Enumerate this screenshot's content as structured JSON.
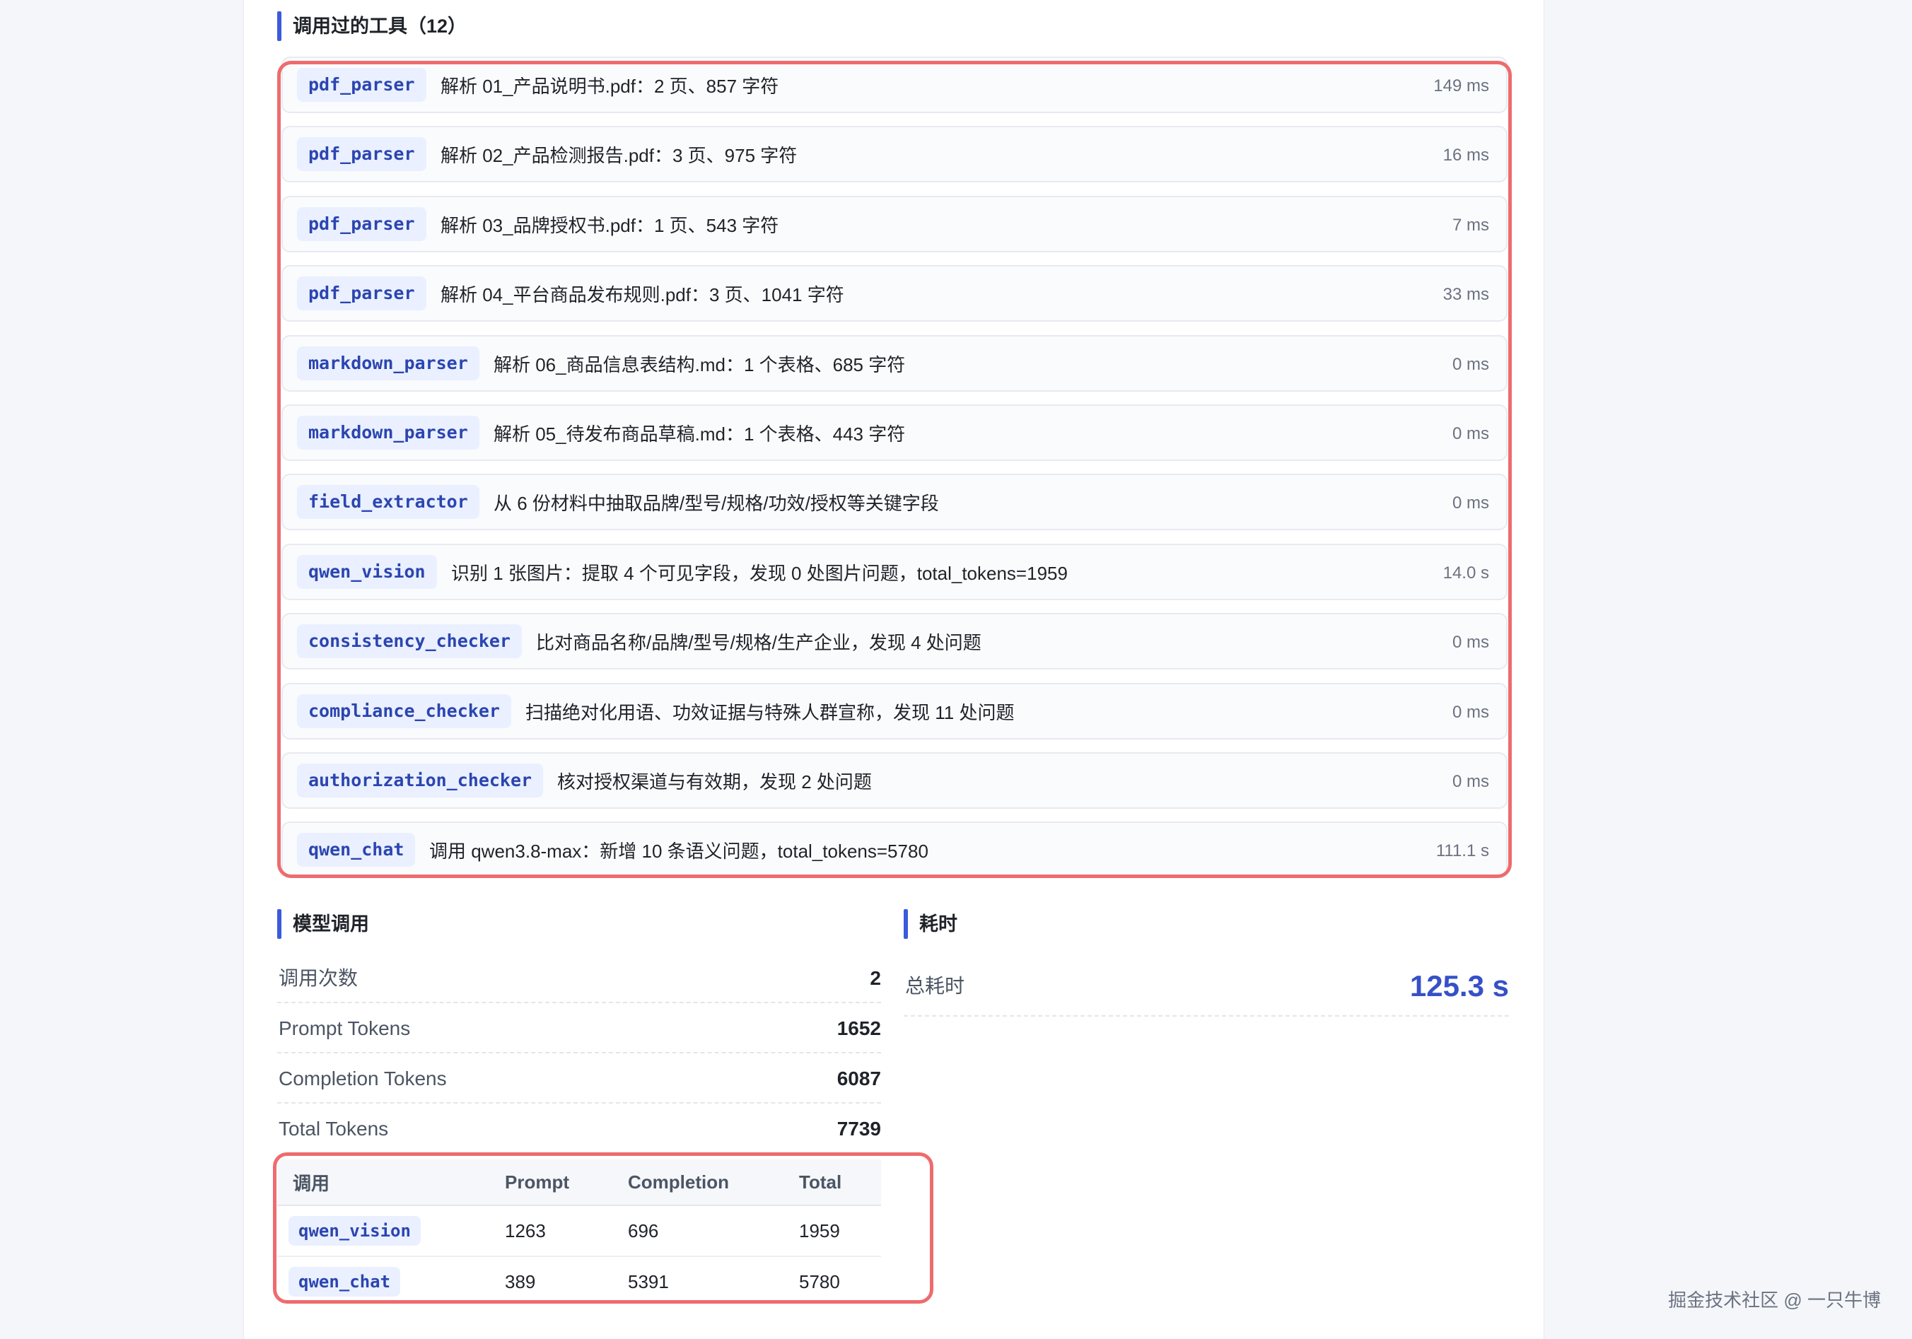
{
  "tools_section": {
    "title": "调用过的工具（12）",
    "items": [
      {
        "tool": "pdf_parser",
        "desc": "解析 01_产品说明书.pdf：2 页、857 字符",
        "duration": "149 ms"
      },
      {
        "tool": "pdf_parser",
        "desc": "解析 02_产品检测报告.pdf：3 页、975 字符",
        "duration": "16 ms"
      },
      {
        "tool": "pdf_parser",
        "desc": "解析 03_品牌授权书.pdf：1 页、543 字符",
        "duration": "7 ms"
      },
      {
        "tool": "pdf_parser",
        "desc": "解析 04_平台商品发布规则.pdf：3 页、1041 字符",
        "duration": "33 ms"
      },
      {
        "tool": "markdown_parser",
        "desc": "解析 06_商品信息表结构.md：1 个表格、685 字符",
        "duration": "0 ms"
      },
      {
        "tool": "markdown_parser",
        "desc": "解析 05_待发布商品草稿.md：1 个表格、443 字符",
        "duration": "0 ms"
      },
      {
        "tool": "field_extractor",
        "desc": "从 6 份材料中抽取品牌/型号/规格/功效/授权等关键字段",
        "duration": "0 ms"
      },
      {
        "tool": "qwen_vision",
        "desc": "识别 1 张图片：提取 4 个可见字段，发现 0 处图片问题，total_tokens=1959",
        "duration": "14.0 s"
      },
      {
        "tool": "consistency_checker",
        "desc": "比对商品名称/品牌/型号/规格/生产企业，发现 4 处问题",
        "duration": "0 ms"
      },
      {
        "tool": "compliance_checker",
        "desc": "扫描绝对化用语、功效证据与特殊人群宣称，发现 11 处问题",
        "duration": "0 ms"
      },
      {
        "tool": "authorization_checker",
        "desc": "核对授权渠道与有效期，发现 2 处问题",
        "duration": "0 ms"
      },
      {
        "tool": "qwen_chat",
        "desc": "调用 qwen3.8-max：新增 10 条语义问题，total_tokens=5780",
        "duration": "111.1 s"
      }
    ]
  },
  "model_section": {
    "title": "模型调用",
    "stats": [
      {
        "label": "调用次数",
        "value": "2"
      },
      {
        "label": "Prompt Tokens",
        "value": "1652"
      },
      {
        "label": "Completion Tokens",
        "value": "6087"
      },
      {
        "label": "Total Tokens",
        "value": "7739"
      }
    ],
    "table": {
      "headers": [
        "调用",
        "Prompt",
        "Completion",
        "Total"
      ],
      "rows": [
        {
          "name": "qwen_vision",
          "prompt": "1263",
          "completion": "696",
          "total": "1959"
        },
        {
          "name": "qwen_chat",
          "prompt": "389",
          "completion": "5391",
          "total": "5780"
        }
      ]
    }
  },
  "time_section": {
    "title": "耗时",
    "label": "总耗时",
    "value": "125.3 s"
  },
  "watermark": "掘金技术社区 @ 一只牛博",
  "colors": {
    "accent": "#3b5bdb",
    "highlight_border": "#ee6b6e",
    "tag_bg": "#eaf0ff",
    "tag_text": "#2b45b0"
  }
}
